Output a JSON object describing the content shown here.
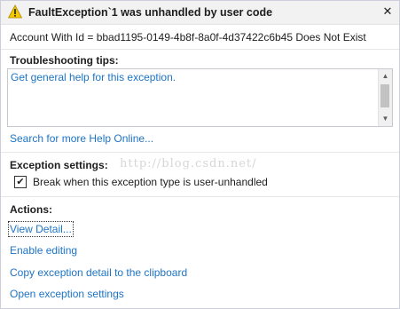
{
  "dialog": {
    "title": "FaultException`1 was unhandled by user code",
    "close_glyph": "✕",
    "message": "Account With Id = bbad1195-0149-4b8f-8a0f-4d37422c6b45 Does Not Exist"
  },
  "troubleshooting": {
    "heading": "Troubleshooting tips:",
    "tips": [
      "Get general help for this exception."
    ],
    "search_link": "Search for more Help Online..."
  },
  "exception_settings": {
    "heading": "Exception settings:",
    "checkbox_label": "Break when this exception type is user-unhandled",
    "checked": true,
    "check_glyph": "✔"
  },
  "watermark": "http://blog.csdn.net/",
  "actions": {
    "heading": "Actions:",
    "items": [
      "View Detail...",
      "Enable editing",
      "Copy exception detail to the clipboard",
      "Open exception settings"
    ]
  },
  "colors": {
    "link": "#1e74c5",
    "header_bg": "#f2f2f2",
    "warning_fill": "#f2c800"
  },
  "icons": {
    "warning": "warning-icon",
    "close": "close-icon",
    "scroll_up": "scroll-up-icon",
    "scroll_down": "scroll-down-icon",
    "check": "checkmark-icon"
  }
}
